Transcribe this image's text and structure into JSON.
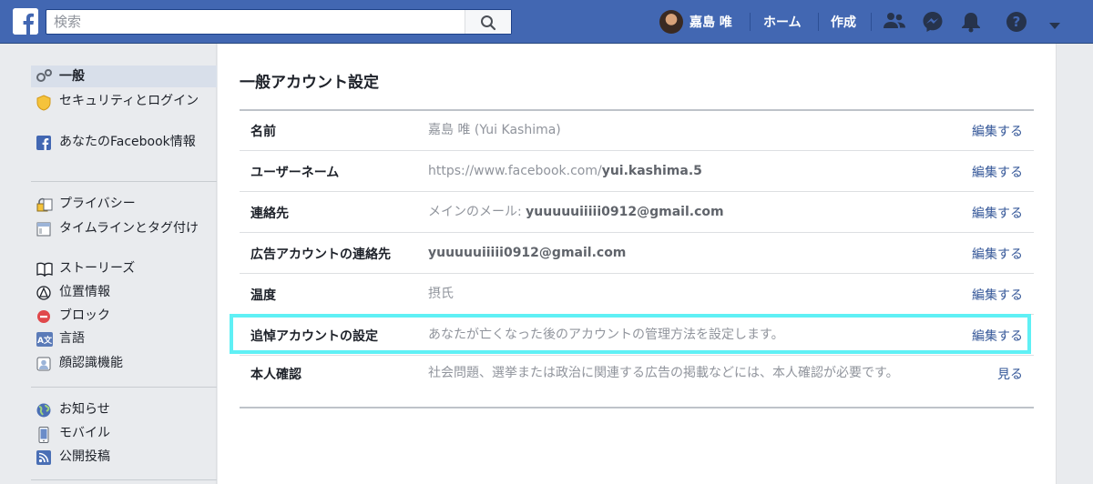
{
  "topbar": {
    "search_placeholder": "検索",
    "user_name": "嘉島 唯",
    "nav_home": "ホーム",
    "nav_create": "作成",
    "icons": [
      "friends-icon",
      "messenger-icon",
      "notifications-icon",
      "help-icon",
      "chevron-down-icon"
    ]
  },
  "sidebar": {
    "groups": [
      [
        {
          "label": "一般",
          "icon": "gear-icon",
          "active": true
        },
        {
          "label": "セキュリティとログイン",
          "icon": "shield-icon"
        },
        {
          "label": "あなたのFacebook情報",
          "icon": "facebook-icon"
        }
      ],
      [
        {
          "label": "プライバシー",
          "icon": "lock-icon"
        },
        {
          "label": "タイムラインとタグ付け",
          "icon": "timeline-icon"
        },
        {
          "label": "ストーリーズ",
          "icon": "book-icon"
        },
        {
          "label": "位置情報",
          "icon": "location-icon"
        },
        {
          "label": "ブロック",
          "icon": "block-icon"
        },
        {
          "label": "言語",
          "icon": "language-icon"
        },
        {
          "label": "顔認識機能",
          "icon": "face-recognition-icon"
        }
      ],
      [
        {
          "label": "お知らせ",
          "icon": "globe-icon"
        },
        {
          "label": "モバイル",
          "icon": "mobile-icon"
        },
        {
          "label": "公開投稿",
          "icon": "rss-icon"
        }
      ]
    ]
  },
  "main": {
    "title": "一般アカウント設定",
    "rows": [
      {
        "label": "名前",
        "value_plain": "嘉島 唯 (Yui Kashima)",
        "value_bold": "",
        "action": "編集する"
      },
      {
        "label": "ユーザーネーム",
        "value_plain": "https://www.facebook.com/",
        "value_bold": "yui.kashima.5",
        "action": "編集する"
      },
      {
        "label": "連絡先",
        "value_plain": "メインのメール: ",
        "value_bold": "yuuuuuiiiii0912@gmail.com",
        "action": "編集する"
      },
      {
        "label": "広告アカウントの連絡先",
        "value_plain": "",
        "value_bold": "yuuuuuiiiii0912@gmail.com",
        "action": "編集する"
      },
      {
        "label": "温度",
        "value_plain": "摂氏",
        "value_bold": "",
        "action": "編集する"
      },
      {
        "label": "追悼アカウントの設定",
        "value_plain": "あなたが亡くなった後のアカウントの管理方法を設定します。",
        "value_bold": "",
        "action": "編集する"
      },
      {
        "label": "本人確認",
        "value_plain": "社会問題、選挙または政治に関連する広告の掲載などには、本人確認が必要です。",
        "value_bold": "",
        "action": "見る"
      }
    ]
  },
  "colors": {
    "brand": "#4267b2",
    "link": "#365899",
    "highlight": "#5ff0f5"
  }
}
